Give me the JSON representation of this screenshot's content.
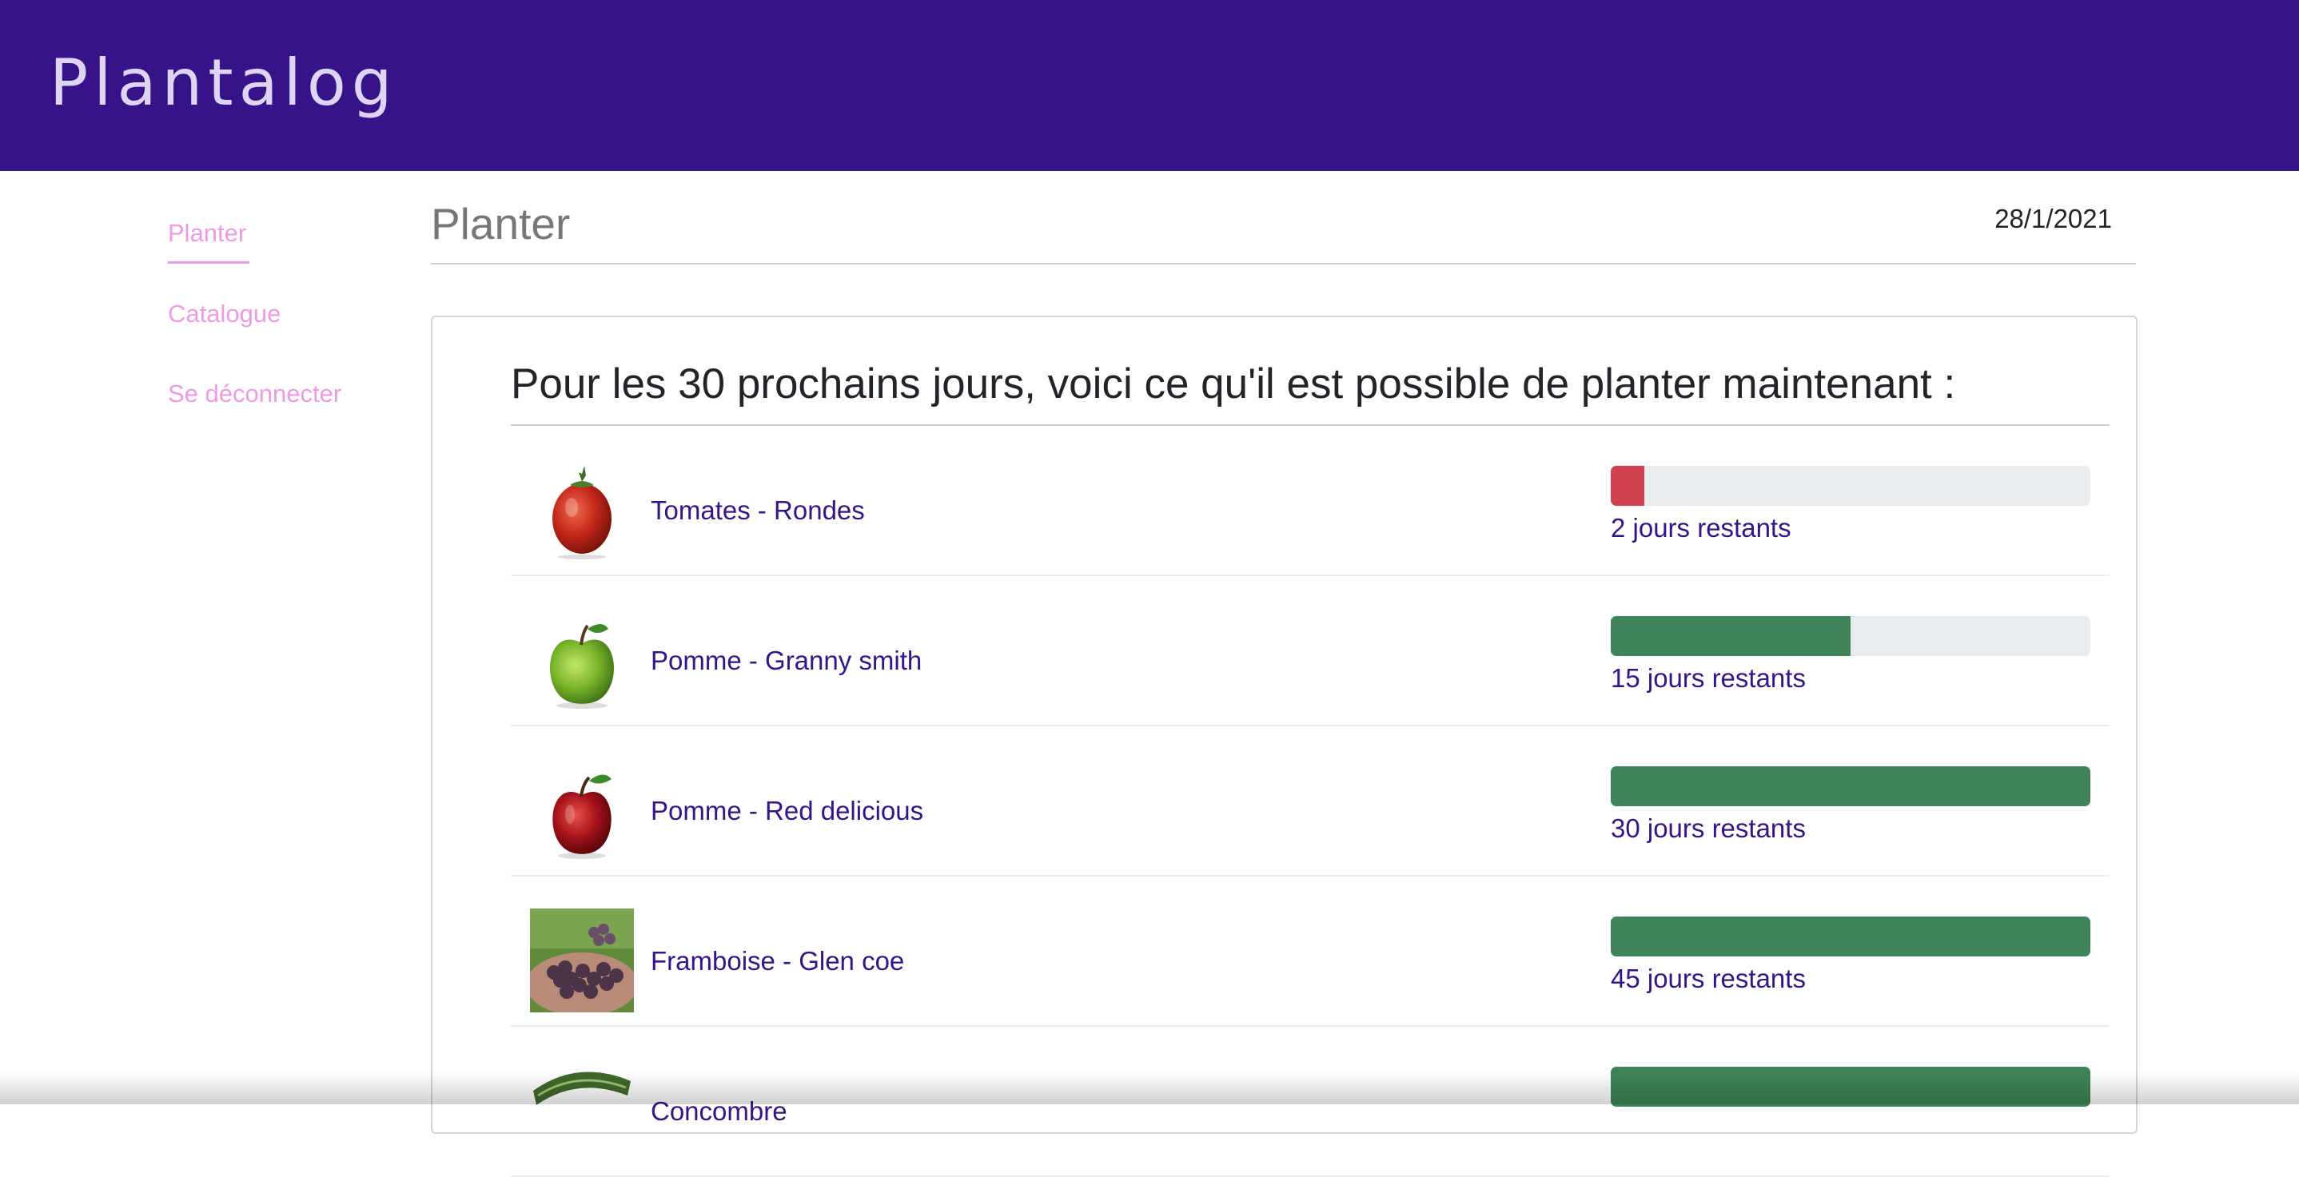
{
  "header": {
    "brand": "Plantalog"
  },
  "sidebar": {
    "items": [
      {
        "label": "Planter",
        "active": true
      },
      {
        "label": "Catalogue",
        "active": false
      },
      {
        "label": "Se déconnecter",
        "active": false
      }
    ]
  },
  "page": {
    "title": "Planter",
    "date": "28/1/2021"
  },
  "card": {
    "heading": "Pour les 30 prochains jours, voici ce qu'il est possible de planter maintenant :"
  },
  "plants": [
    {
      "name": "Tomates - Rondes",
      "days_text": "2 jours restants",
      "progress_fraction": 0.07,
      "status": "danger",
      "icon": "tomato-image"
    },
    {
      "name": "Pomme - Granny smith",
      "days_text": "15 jours restants",
      "progress_fraction": 0.5,
      "status": "success",
      "icon": "green-apple-image"
    },
    {
      "name": "Pomme - Red delicious",
      "days_text": "30 jours restants",
      "progress_fraction": 1.0,
      "status": "success",
      "icon": "red-apple-image"
    },
    {
      "name": "Framboise - Glen coe",
      "days_text": "45 jours restants",
      "progress_fraction": 1.0,
      "status": "success",
      "icon": "raspberry-image"
    },
    {
      "name": "Concombre",
      "days_text": "",
      "progress_fraction": 1.0,
      "status": "success",
      "icon": "cucumber-image"
    }
  ],
  "colors": {
    "header_bg": "#371389",
    "link": "#371389",
    "nav": "#ef9ae6",
    "progress_success": "#3e8458",
    "progress_danger": "#d04250",
    "progress_track": "#e9ecef"
  }
}
